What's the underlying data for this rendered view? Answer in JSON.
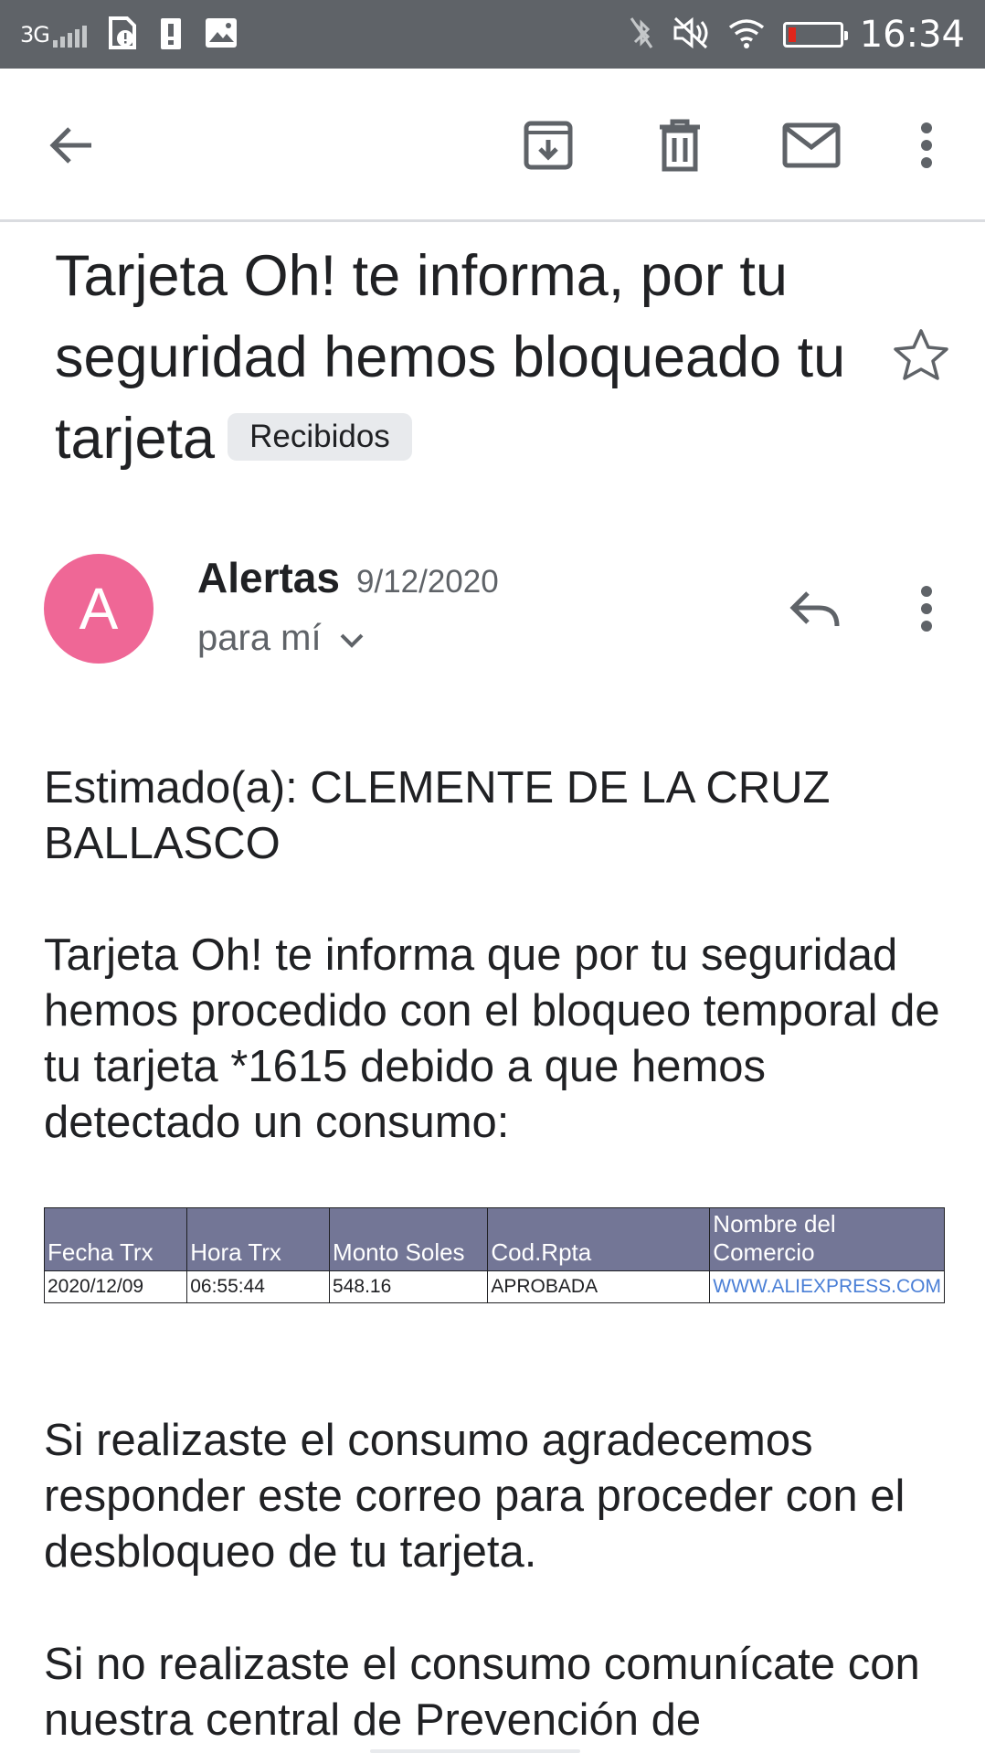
{
  "status_bar": {
    "network": "3G",
    "time": "16:34",
    "icons": [
      "signal-icon",
      "sim-alert-icon",
      "warning-icon",
      "image-icon",
      "bluetooth-off-icon",
      "mute-icon",
      "wifi-icon",
      "battery-low-icon"
    ]
  },
  "toolbar": {
    "icons": [
      "back-arrow-icon",
      "archive-icon",
      "delete-icon",
      "mark-unread-icon",
      "more-vert-icon"
    ]
  },
  "email": {
    "subject": "Tarjeta Oh! te informa, por tu seguridad hemos bloqueado tu tarjeta",
    "label": "Recibidos",
    "sender": {
      "avatar_letter": "A",
      "avatar_color": "#ef6796",
      "name": "Alertas",
      "date": "9/12/2020",
      "recipient": "para mí"
    },
    "body": {
      "greeting": "Estimado(a):  CLEMENTE DE LA CRUZ BALLASCO",
      "paragraph1": "Tarjeta Oh! te informa que por tu seguridad hemos procedido con el bloqueo temporal de tu tarjeta *1615 debido a que hemos detectado un consumo:",
      "table": {
        "headers": [
          "Fecha Trx",
          "Hora Trx",
          "Monto Soles",
          "Cod.Rpta",
          "Nombre del Comercio"
        ],
        "row": [
          "2020/12/09",
          "06:55:44",
          "548.16",
          "APROBADA",
          "WWW.ALIEXPRESS.COM"
        ]
      },
      "paragraph2": "Si realizaste el consumo agradecemos responder este correo para proceder con el desbloqueo de tu tarjeta.",
      "paragraph3": "Si no realizaste el consumo comunícate con nuestra central de Prevención de"
    }
  },
  "colors": {
    "status_bar_bg": "#5f6368",
    "table_header_bg": "#737696",
    "link": "#4a7fd6"
  }
}
